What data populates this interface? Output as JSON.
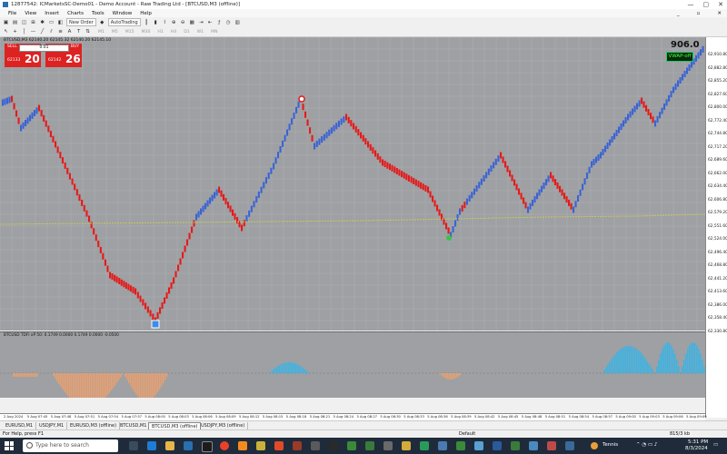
{
  "window": {
    "title": "12877542: ICMarketsSC-Demo01 - Demo Account - Raw Trading Ltd - [BTCUSD,M3 (offline)]",
    "controls": [
      "—",
      "▢",
      "✕"
    ]
  },
  "menu": {
    "items": [
      "File",
      "View",
      "Insert",
      "Charts",
      "Tools",
      "Window",
      "Help"
    ],
    "right_controls": [
      "_",
      "▫",
      "✕"
    ]
  },
  "toolbar": {
    "new_order": "New Order",
    "auto_trading": "AutoTrading",
    "timeframes": [
      "M1",
      "M5",
      "M15",
      "M30",
      "H1",
      "H4",
      "D1",
      "W1",
      "MN"
    ]
  },
  "chart": {
    "header": "BTCUSD,M3  62140.20 62145.32 62140.20 62145.10",
    "trade_panel": {
      "sell_label": "SELL",
      "buy_label": "BUY",
      "lot": "0.01",
      "sell_small": "62133",
      "sell_big": "20",
      "buy_small": "62142",
      "buy_big": "26"
    },
    "big_value": "906.0",
    "vwap_label": "VWAP-off",
    "price_labels": [
      "62,910.80",
      "62,882.80",
      "62,855.20",
      "62,827.60",
      "62,800.00",
      "62,772.40",
      "62,744.80",
      "62,717.20",
      "62,689.60",
      "62,662.00",
      "62,634.40",
      "62,606.80",
      "62,579.20",
      "62,551.60",
      "62,524.00",
      "62,496.40",
      "62,468.80",
      "62,441.20",
      "62,413.60",
      "62,386.00",
      "62,358.40",
      "62,330.80"
    ],
    "colors": {
      "up": "#3a63d4",
      "down": "#e51a1a",
      "vwap": "#c8c85a",
      "background": "#9ea0a3"
    }
  },
  "indicator": {
    "header": "BTCUSD TDFI xP 50: 0.1749 0.0000 0.1749 0.0000 -0.0500",
    "colors": {
      "positive": "#3ab4e6",
      "negative": "#e8a070"
    }
  },
  "time_labels": [
    "2 Aug 2024",
    "5 Aug 07:45",
    "5 Aug 07:48",
    "5 Aug 07:51",
    "5 Aug 07:54",
    "5 Aug 07:57",
    "5 Aug 08:00",
    "5 Aug 08:03",
    "5 Aug 08:06",
    "5 Aug 08:09",
    "5 Aug 08:12",
    "5 Aug 08:15",
    "5 Aug 08:18",
    "5 Aug 08:21",
    "5 Aug 08:24",
    "5 Aug 08:27",
    "5 Aug 08:30",
    "5 Aug 08:33",
    "5 Aug 08:36",
    "5 Aug 08:39",
    "5 Aug 08:42",
    "5 Aug 08:45",
    "5 Aug 08:48",
    "5 Aug 08:51",
    "5 Aug 08:54",
    "5 Aug 08:57",
    "5 Aug 09:00",
    "5 Aug 09:03",
    "5 Aug 09:06",
    "5 Aug 09:09"
  ],
  "tabs": [
    "EURUSD,M1",
    "USDJPY,M1",
    "EURUSD,M3 (offline)",
    "BTCUSD,M1",
    "BTCUSD,M3 (offline)",
    "USDJPY,M3 (offline)"
  ],
  "status": {
    "help": "For Help, press F1",
    "profile": "Default",
    "traffic": "815/3 kb"
  },
  "taskbar": {
    "search_placeholder": "Type here to search",
    "weather": "Tennis",
    "time": "5:31 PM",
    "date": "8/3/2024"
  }
}
